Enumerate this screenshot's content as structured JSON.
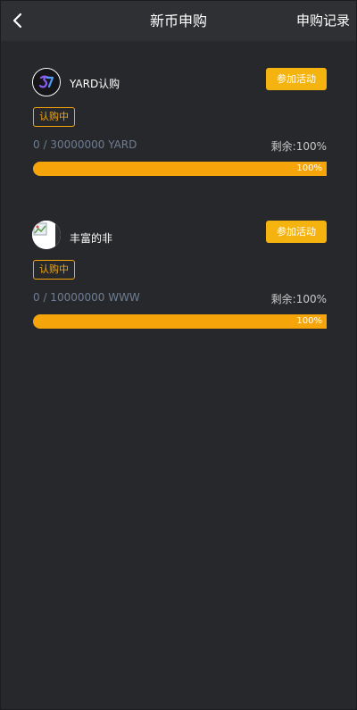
{
  "header": {
    "back_icon": "chevron-left-icon",
    "title": "新币申购",
    "records_label": "申购记录"
  },
  "colors": {
    "accent": "#f5a50a",
    "button": "#f5b30f",
    "background": "#27282b",
    "header": "#2f3034"
  },
  "items": [
    {
      "icon": "yard-logo-icon",
      "name": "YARD认购",
      "join_label": "参加活动",
      "status": "认购中",
      "amount": "0 / 30000000 YARD",
      "remain_label": "剩余:",
      "remain_value": "100%",
      "progress_label": "100%",
      "progress": 1.0
    },
    {
      "icon": "broken-image-icon",
      "name": "丰富的非",
      "join_label": "参加活动",
      "status": "认购中",
      "amount": "0 / 10000000 WWW",
      "remain_label": "剩余:",
      "remain_value": "100%",
      "progress_label": "100%",
      "progress": 1.0
    }
  ]
}
